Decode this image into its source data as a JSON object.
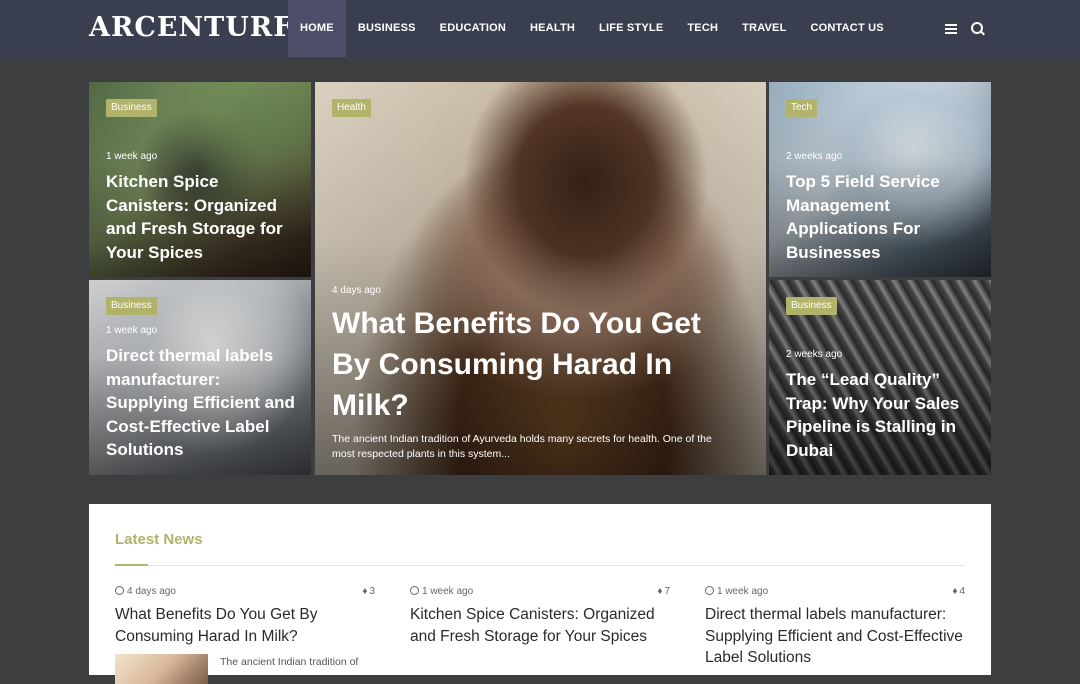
{
  "header": {
    "logo": "ARCENTURF",
    "nav": [
      "HOME",
      "BUSINESS",
      "EDUCATION",
      "HEALTH",
      "LIFE STYLE",
      "TECH",
      "TRAVEL",
      "CONTACT US"
    ]
  },
  "hero": {
    "cards": [
      {
        "badge": "Business",
        "date": "1 week ago",
        "title": "Kitchen Spice Canisters: Organized and Fresh Storage for Your Spices"
      },
      {
        "badge": "Business",
        "date": "1 week ago",
        "title": "Direct thermal labels manufacturer: Supplying Efficient and Cost-Effective Label Solutions"
      },
      {
        "badge": "Health",
        "date": "4 days ago",
        "title": "What Benefits Do You Get By Consuming Harad In Milk?",
        "excerpt": "The ancient Indian tradition of Ayurveda holds many secrets for health. One of the most respected plants in this system..."
      },
      {
        "badge": "Tech",
        "date": "2 weeks ago",
        "title": "Top 5 Field Service Management Applications For Businesses"
      },
      {
        "badge": "Business",
        "date": "2 weeks ago",
        "title": "The “Lead Quality” Trap: Why Your Sales Pipeline is Stalling in Dubai"
      }
    ]
  },
  "latest": {
    "title": "Latest News",
    "items": [
      {
        "date": "4 days ago",
        "views": "3",
        "title": "What Benefits Do You Get By Consuming Harad In Milk?",
        "excerpt": "The ancient Indian tradition of"
      },
      {
        "date": "1 week ago",
        "views": "7",
        "title": "Kitchen Spice Canisters: Organized and Fresh Storage for Your Spices"
      },
      {
        "date": "1 week ago",
        "views": "4",
        "title": "Direct thermal labels manufacturer: Supplying Efficient and Cost-Effective Label Solutions"
      }
    ]
  },
  "colors": {
    "header_bg": "#3a3f4f",
    "page_bg": "#3d3e40",
    "accent": "#b1b36a",
    "nav_active": "#4d4f6a"
  }
}
